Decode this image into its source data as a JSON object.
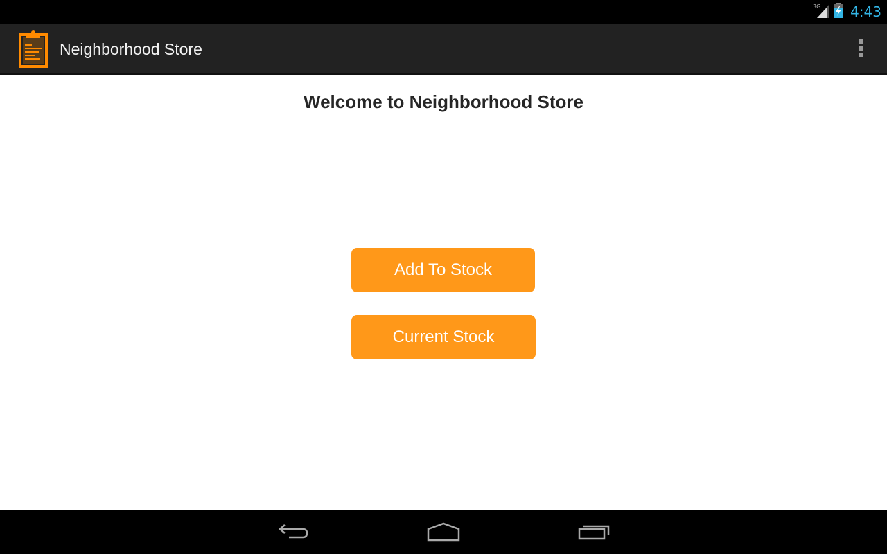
{
  "status_bar": {
    "network": "3G",
    "clock": "4:43",
    "clock_color": "#33b5e5"
  },
  "action_bar": {
    "title": "Neighborhood Store",
    "app_icon": "clipboard-icon",
    "overflow_icon": "overflow-menu-icon"
  },
  "main": {
    "welcome": "Welcome to Neighborhood Store",
    "buttons": [
      {
        "label": "Add To Stock"
      },
      {
        "label": "Current Stock"
      }
    ],
    "accent_color": "#ff9819"
  },
  "nav_bar": {
    "icons": [
      "back-icon",
      "home-icon",
      "recent-apps-icon"
    ]
  }
}
